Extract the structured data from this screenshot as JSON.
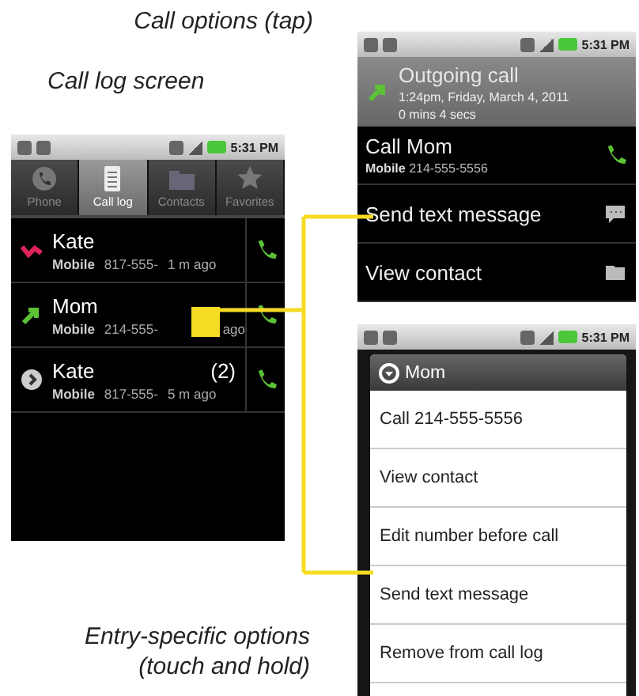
{
  "captions": {
    "call_options": "Call options (tap)",
    "call_log_screen": "Call log screen",
    "entry_options": "Entry-specific options (touch and hold)"
  },
  "call_log_phone": {
    "status_time": "5:31 PM",
    "tabs": [
      {
        "label": "Phone",
        "kind": "phone",
        "selected": false
      },
      {
        "label": "Call log",
        "kind": "log",
        "selected": true
      },
      {
        "label": "Contacts",
        "kind": "contacts",
        "selected": false
      },
      {
        "label": "Favorites",
        "kind": "favorites",
        "selected": false
      }
    ],
    "calls": [
      {
        "kind": "missed",
        "name": "Kate",
        "type": "Mobile",
        "number": "817-555-",
        "time": "1 m ago"
      },
      {
        "kind": "outgoing",
        "name": "Mom",
        "type": "Mobile",
        "number": "214-555-",
        "time": "ago",
        "highlighted": true
      },
      {
        "kind": "group",
        "name": "Kate",
        "count": "(2)",
        "type": "Mobile",
        "number": "817-555-",
        "time": "5 m ago"
      }
    ]
  },
  "call_options_phone": {
    "status_time": "5:31 PM",
    "header": {
      "title": "Outgoing call",
      "date": "1:24pm, Friday, March 4, 2011",
      "duration": "0 mins 4 secs"
    },
    "options": [
      {
        "kind": "call",
        "label": "Call Mom",
        "type": "Mobile",
        "number": "214-555-5556"
      },
      {
        "kind": "message",
        "label": "Send text message"
      },
      {
        "kind": "contact",
        "label": "View contact"
      }
    ]
  },
  "entry_options_phone": {
    "status_time": "5:31 PM",
    "dialog_title": "Mom",
    "items": [
      "Call 214-555-5556",
      "View contact",
      "Edit number before call",
      "Send text message",
      "Remove from call log"
    ]
  }
}
